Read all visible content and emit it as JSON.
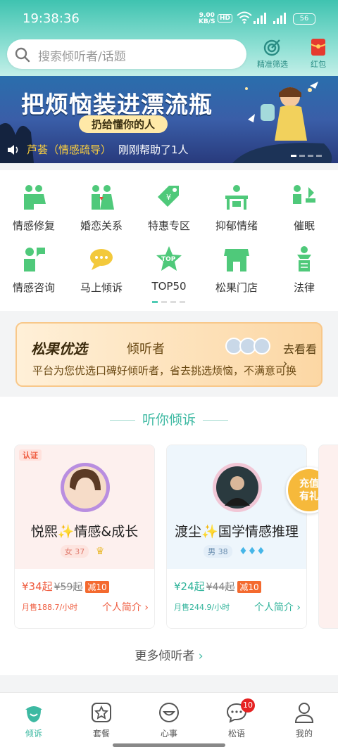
{
  "status": {
    "time": "19:38:36",
    "speed_value": "9.00",
    "speed_unit": "KB/S",
    "hd": "HD",
    "battery": "56"
  },
  "header": {
    "search_placeholder": "搜索倾听者/话题",
    "filter_label": "精准筛选",
    "redpacket_label": "红包"
  },
  "banner": {
    "title": "把烦恼装进漂流瓶",
    "subtitle": "扔给懂你的人",
    "notice_name": "芦荟（情感疏导）",
    "notice_text": "刚刚帮助了1人"
  },
  "categories": [
    {
      "label": "情感修复",
      "icon": "couple-icon"
    },
    {
      "label": "婚恋关系",
      "icon": "marriage-icon"
    },
    {
      "label": "特惠专区",
      "icon": "discount-tag-icon"
    },
    {
      "label": "抑郁情绪",
      "icon": "desk-icon"
    },
    {
      "label": "催眠",
      "icon": "hypnosis-icon"
    },
    {
      "label": "情感咨询",
      "icon": "consult-icon"
    },
    {
      "label": "马上倾诉",
      "icon": "chat-bubble-icon"
    },
    {
      "label": "TOP50",
      "icon": "star-top-icon"
    },
    {
      "label": "松果门店",
      "icon": "store-icon"
    },
    {
      "label": "法律",
      "icon": "law-icon"
    }
  ],
  "promo": {
    "brand": "松果优选",
    "kind": "倾听者",
    "go": "去看看",
    "desc": "平台为您优选口碑好倾听者，省去挑选烦恼，不满意可换"
  },
  "section": {
    "title": "听你倾诉",
    "more": "更多倾听者"
  },
  "listeners": [
    {
      "badge": "认证",
      "name": "悦熙✨情感&成长",
      "gender_age": "女 37",
      "price": "¥34起",
      "old_price": "¥59起",
      "discount": "减10",
      "sales": "月售188.7/小时",
      "intro": "个人简介"
    },
    {
      "badge": "",
      "name": "渡尘✨国学情感推理",
      "gender_age": "男 38",
      "price": "¥24起",
      "old_price": "¥44起",
      "discount": "减10",
      "sales": "月售244.9/小时",
      "intro": "个人简介",
      "promo_badge": "充值有礼"
    }
  ],
  "tabs": [
    {
      "label": "倾诉",
      "icon": "acorn-icon"
    },
    {
      "label": "套餐",
      "icon": "star-box-icon"
    },
    {
      "label": "心事",
      "icon": "smile-icon"
    },
    {
      "label": "松语",
      "icon": "message-icon",
      "badge": "10"
    },
    {
      "label": "我的",
      "icon": "profile-icon"
    }
  ],
  "colors": {
    "accent": "#3db9a2",
    "price": "#ef5b3e"
  }
}
